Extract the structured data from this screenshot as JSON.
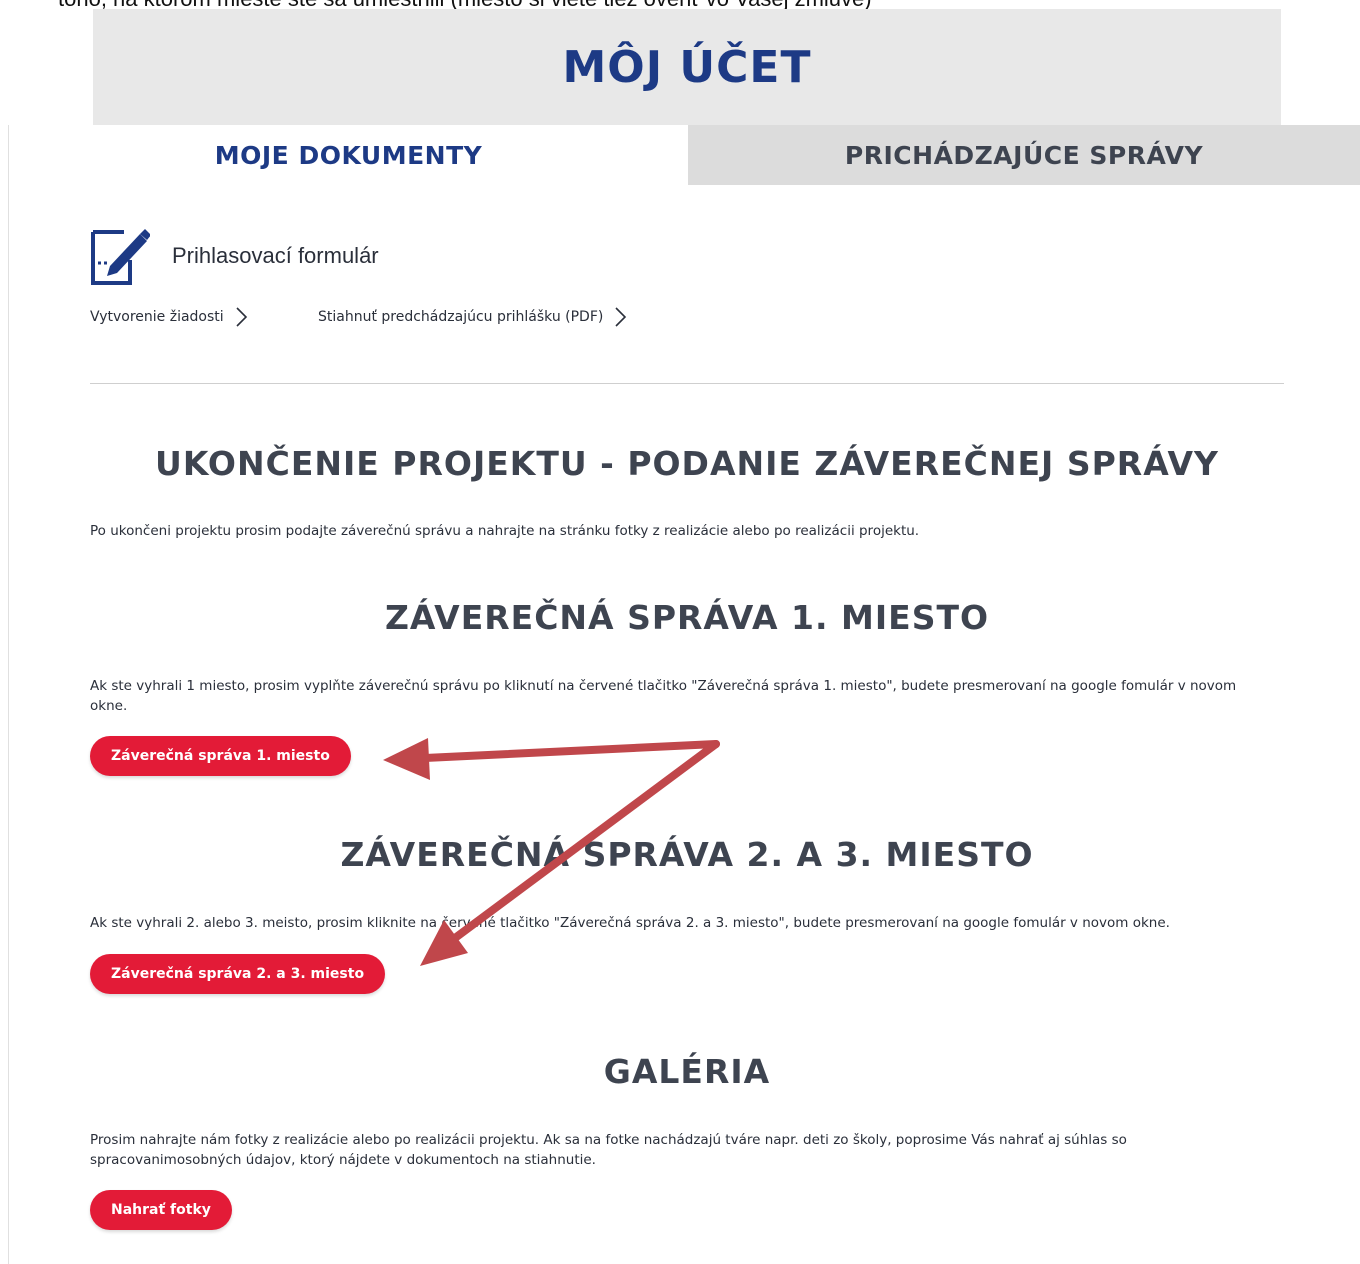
{
  "page": {
    "cut_top_text": "tohó, na ktorom mieste ste sa umiestnili (miesto si viete tiež overiť vo Vašej zmluve)"
  },
  "header": {
    "title": "MÔJ ÚČET"
  },
  "tabs": [
    {
      "label": "MOJE DOKUMENTY",
      "active": true
    },
    {
      "label": "PRICHÁDZAJÚCE SPRÁVY",
      "active": false
    }
  ],
  "form": {
    "icon": "edit-document-icon",
    "label": "Prihlasovací formulár",
    "links": [
      {
        "label": "Vytvorenie žiadosti",
        "icon": "chevron-right-icon"
      },
      {
        "label": "Stiahnuť predchádzajúcu prihlášku (PDF)",
        "icon": "chevron-right-icon"
      }
    ]
  },
  "project_end": {
    "title": "UKONČENIE PROJEKTU - PODANIE ZÁVEREČNEJ SPRÁVY",
    "text": "Po ukončeni projektu prosim podajte záverečnú správu a nahrajte na stránku fotky z realizácie alebo po realizácii projektu."
  },
  "report_first": {
    "title": "ZÁVEREČNÁ SPRÁVA 1. MIESTO",
    "text": "Ak ste vyhrali 1 miesto, prosim vyplňte záverečnú správu po kliknutí na červené tlačitko \"Záverečná správa 1. miesto\", budete presmerovaní na google fomulár v novom okne.",
    "button": "Záverečná správa 1. miesto"
  },
  "report_second": {
    "title": "ZÁVEREČNÁ SPRÁVA 2. A 3. MIESTO",
    "text": "Ak ste vyhrali 2. alebo 3. meisto, prosim kliknite na červené tlačitko \"Záverečná správa 2. a 3. miesto\", budete presmerovaní na google fomulár v novom okne.",
    "button": "Záverečná správa 2. a 3. miesto"
  },
  "gallery": {
    "title": "GALÉRIA",
    "text": "Prosim nahrajte nám fotky z realizácie alebo po realizácii projektu. Ak sa na fotke nachádzajú tváre napr. deti zo školy, poprosime Vás nahrať aj súhlas so spracovanimosobných údajov, ktorý nájdete v dokumentoch na stiahnutie.",
    "button": "Nahrať fotky"
  },
  "colors": {
    "navy": "#1d3a85",
    "button_red": "#e31b37",
    "heading_gray": "#3e4450",
    "arrow_red": "#c0474b",
    "header_bg": "#e8e8e8",
    "tab_inactive_bg": "#dcdcdc"
  },
  "annotation": {
    "icon": "red-arrow-annotation"
  }
}
